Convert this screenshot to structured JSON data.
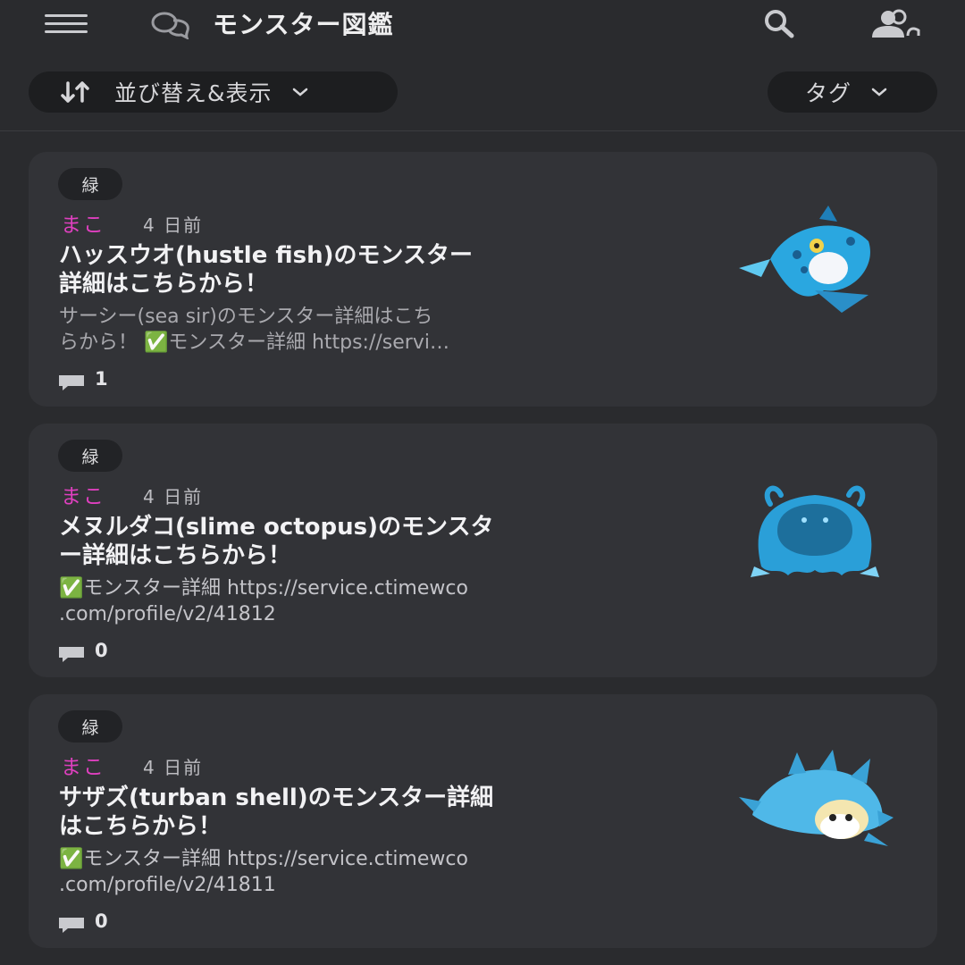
{
  "header": {
    "title": "モンスター図鑑",
    "icons": [
      "menu-icon",
      "chat-bubbles-icon",
      "search-icon",
      "users-icon"
    ]
  },
  "filters": {
    "sort_label": "並び替え&表示",
    "tag_label": "タグ"
  },
  "colors": {
    "background": "#2a2b2e",
    "card": "#323337",
    "author": "#e040c0"
  },
  "posts": [
    {
      "tag": "緑",
      "author": "まこ",
      "time_ago": "4 日前",
      "title": "ハッスウオ(hustle fish)のモンスター\n詳細はこちらから！",
      "excerpt": "サーシー(sea sir)のモンスター詳細はこち\nらから！ ✅モンスター詳細 https://servi…",
      "comment_count": "1",
      "thumbnail": "blue-fish-monster"
    },
    {
      "tag": "緑",
      "author": "まこ",
      "time_ago": "4 日前",
      "title": "メヌルダコ(slime octopus)のモンスタ\nー詳細はこちらから！",
      "excerpt": "✅モンスター詳細 https://service.ctimewco\n.com/profile/v2/41812",
      "comment_count": "0",
      "thumbnail": "blue-octopus-monster"
    },
    {
      "tag": "緑",
      "author": "まこ",
      "time_ago": "4 日前",
      "title": "サザズ(turban shell)のモンスター詳細\nはこちらから！",
      "excerpt": "✅モンスター詳細 https://service.ctimewco\n.com/profile/v2/41811",
      "comment_count": "0",
      "thumbnail": "spiky-shell-monster"
    }
  ]
}
